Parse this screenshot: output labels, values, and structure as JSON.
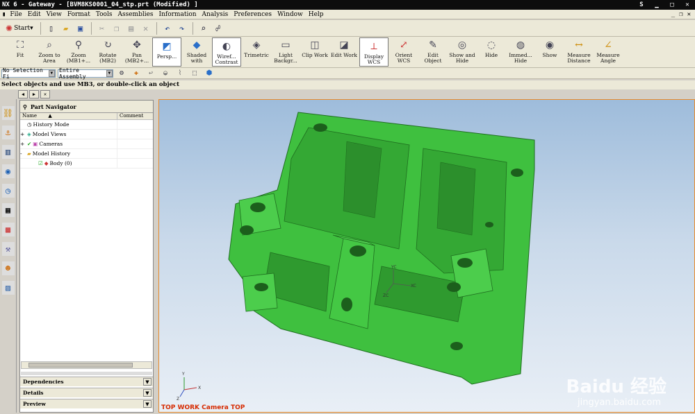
{
  "title": "NX 6 - Gateway - [BVM8KS0001_04_stp.prt (Modified) ]",
  "title_right": "S",
  "menu": [
    "File",
    "Edit",
    "View",
    "Format",
    "Tools",
    "Assemblies",
    "Information",
    "Analysis",
    "Preferences",
    "Window",
    "Help"
  ],
  "start_label": "Start▾",
  "view_toolbar": [
    {
      "label": "Fit",
      "icon": "fit-icon"
    },
    {
      "label": "Zoom to Area",
      "icon": "zoom-area-icon"
    },
    {
      "label": "Zoom (MB1+...",
      "icon": "zoom-icon"
    },
    {
      "label": "Rotate (MB2)",
      "icon": "rotate-icon"
    },
    {
      "label": "Pan (MB2+...",
      "icon": "pan-icon"
    },
    {
      "label": "Persp...",
      "icon": "perspective-icon"
    },
    {
      "label": "Shaded with",
      "icon": "shaded-icon"
    },
    {
      "label": "Wiref... Contrast",
      "icon": "wireframe-icon"
    },
    {
      "label": "Trimetric",
      "icon": "trimetric-icon"
    },
    {
      "label": "Light Backgr...",
      "icon": "background-icon"
    },
    {
      "label": "Clip Work",
      "icon": "clip-icon"
    },
    {
      "label": "Edit Work",
      "icon": "edit-section-icon"
    },
    {
      "label": "Display WCS",
      "icon": "wcs-display-icon"
    },
    {
      "label": "Orient WCS",
      "icon": "orient-wcs-icon"
    },
    {
      "label": "Edit Object",
      "icon": "edit-object-icon"
    },
    {
      "label": "Show and Hide",
      "icon": "show-hide-icon"
    },
    {
      "label": "Hide",
      "icon": "hide-icon"
    },
    {
      "label": "Immed... Hide",
      "icon": "immediate-hide-icon"
    },
    {
      "label": "Show",
      "icon": "show-icon"
    },
    {
      "label": "Measure Distance",
      "icon": "measure-distance-icon"
    },
    {
      "label": "Measure Angle",
      "icon": "measure-angle-icon"
    }
  ],
  "selection_filter": "No Selection Fi",
  "scope": "Entire Assembly",
  "cue_line": "Select objects and use MB3, or double-click an object",
  "navigator": {
    "title": "Part Navigator",
    "col_name": "Name",
    "col_comment": "Comment",
    "rows": [
      {
        "label": "History Mode",
        "indent": 1,
        "expand": ""
      },
      {
        "label": "Model Views",
        "indent": 1,
        "expand": "+"
      },
      {
        "label": "Cameras",
        "indent": 1,
        "expand": "+"
      },
      {
        "label": "Model History",
        "indent": 1,
        "expand": "-"
      },
      {
        "label": "Body (0)",
        "indent": 2,
        "expand": ""
      }
    ],
    "panels": [
      "Dependencies",
      "Details",
      "Preview"
    ]
  },
  "viewport_label": "TOP WORK Camera TOP",
  "axis_labels": {
    "x": "X",
    "y": "Y",
    "z": "Z",
    "xc": "XC",
    "yc": "YC",
    "zc": "ZC"
  },
  "watermark": "Baidu 经验",
  "watermark_url": "jingyan.baidu.com",
  "colors": {
    "model": "#3fc03f",
    "model_dark": "#2e8f2e",
    "viewport_top": "#9ebcdb",
    "viewport_bottom": "#e9eff6",
    "label": "#d62a00"
  }
}
